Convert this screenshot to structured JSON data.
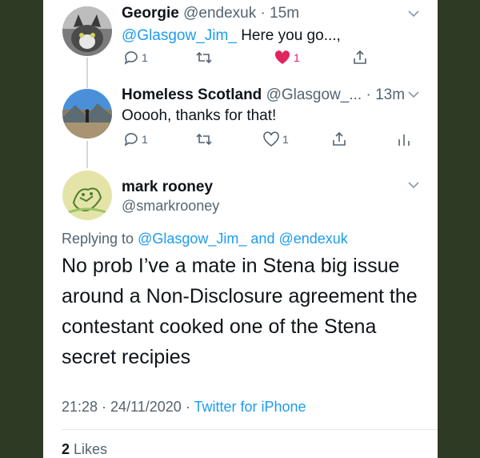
{
  "tweets": [
    {
      "name": "Georgie",
      "handle": "@endexuk",
      "time": "15m",
      "mention": "@Glasgow_Jim_",
      "text": "Here you go...,",
      "reply_count": "1",
      "like_count": "1",
      "avatar_icon": "cat-avatar"
    },
    {
      "name": "Homeless Scotland",
      "handle": "@Glasgow_...",
      "time": "13m",
      "text": "Ooooh, thanks for that!",
      "reply_count": "1",
      "like_count": "1",
      "avatar_icon": "mountain-avatar"
    }
  ],
  "main_tweet": {
    "name": "mark rooney",
    "handle": "@smarkrooney",
    "replying_label": "Replying to",
    "replying_mention_1": "@Glasgow_Jim_",
    "replying_and": "and",
    "replying_mention_2": "@endexuk",
    "text": "No prob I’ve a mate in Stena big issue around a Non-Disclosure agreement the contestant cooked one of the Stena secret recipies",
    "time": "21:28",
    "date": "24/11/2020",
    "source": "Twitter for iPhone",
    "likes_count": "2",
    "likes_label": "Likes"
  },
  "colors": {
    "accent": "#1d9bf0",
    "like": "#e0245e",
    "muted": "#536471",
    "background_outer": "#2f3a24"
  }
}
